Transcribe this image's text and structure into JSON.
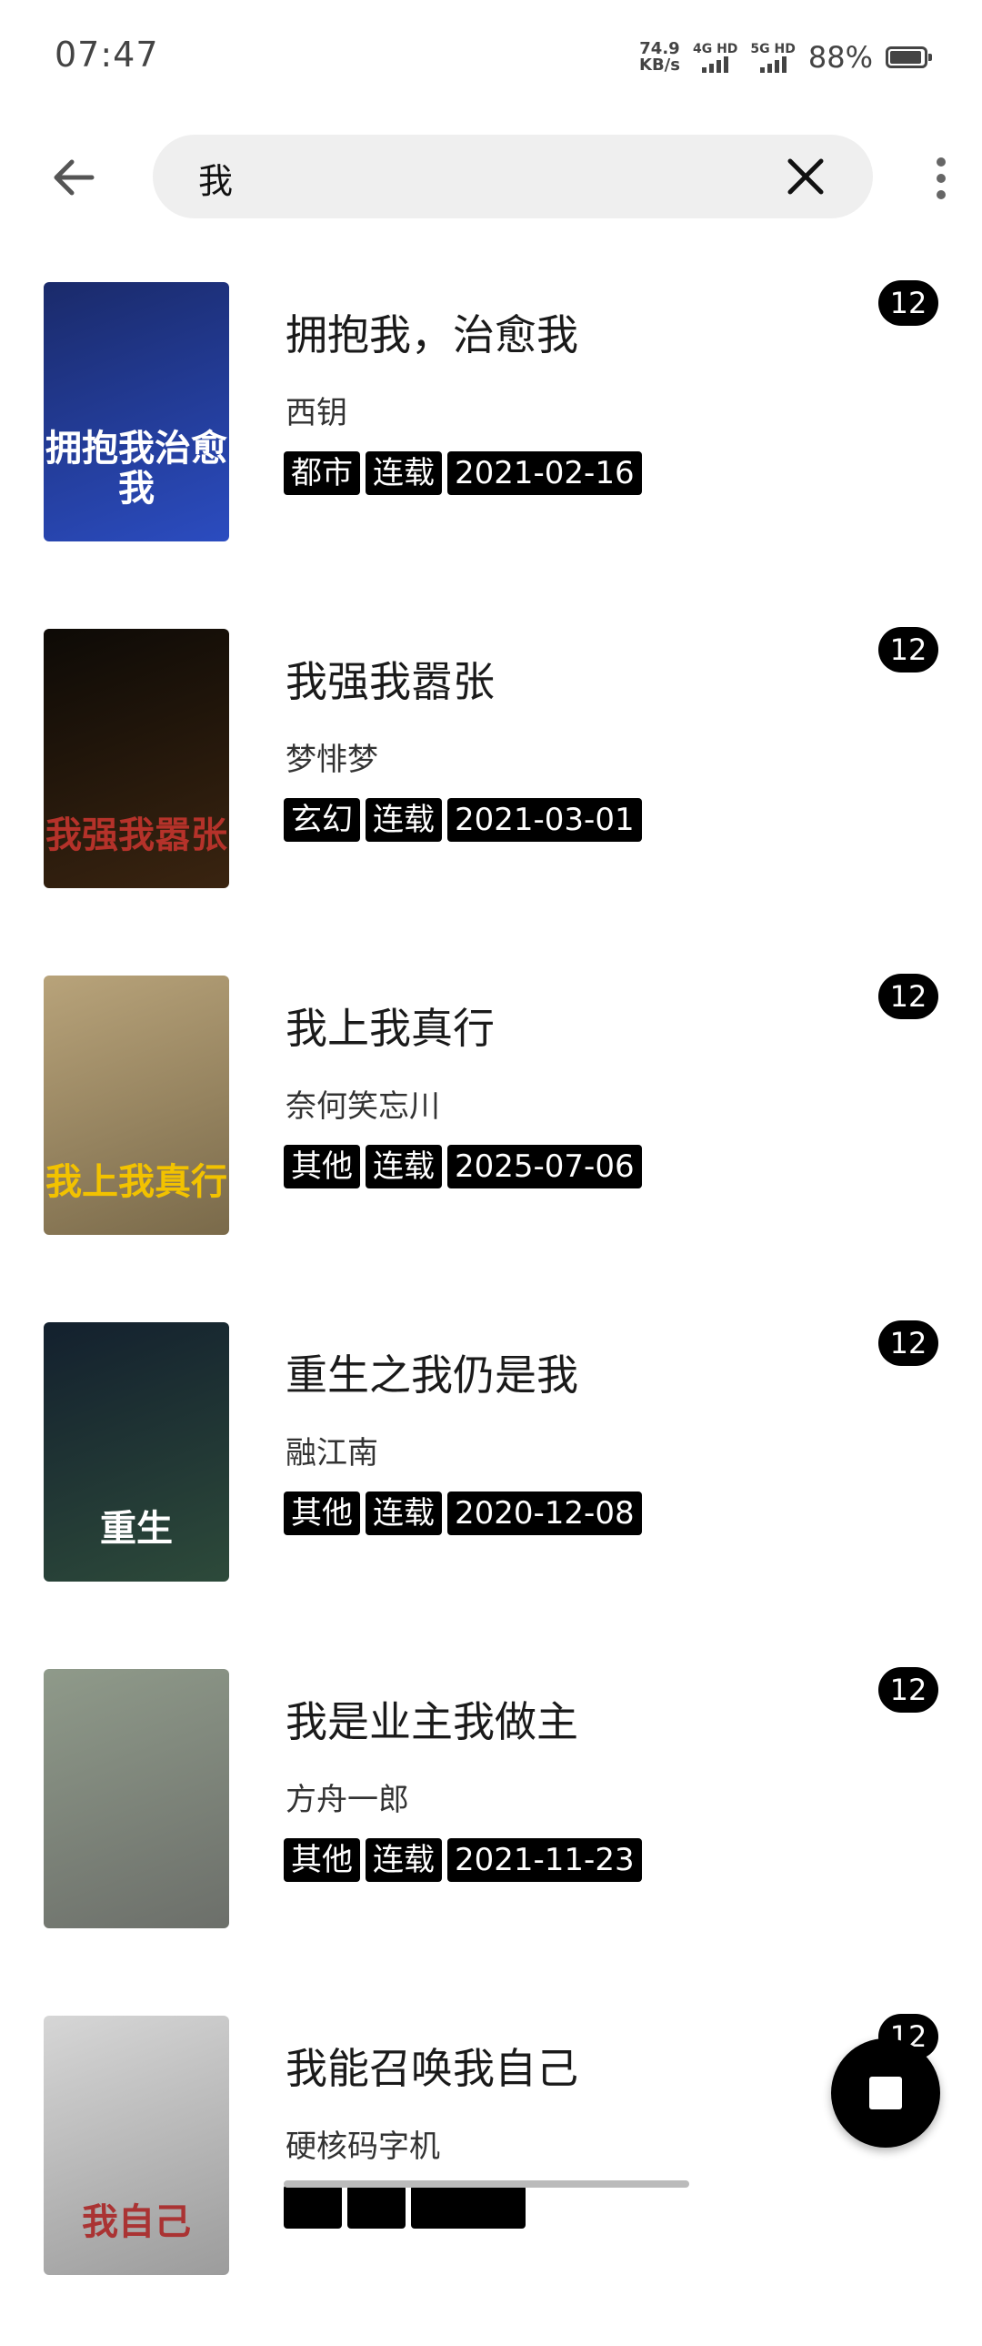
{
  "status": {
    "time": "07:47",
    "net_speed_value": "74.9",
    "net_speed_unit": "KB/s",
    "sim1_label": "4G HD",
    "sim2_label": "5G HD",
    "battery": "88%"
  },
  "search": {
    "query": "我"
  },
  "books": [
    {
      "title": "拥抱我，治愈我",
      "author": "西钥",
      "tags": [
        "都市",
        "连载",
        "2021-02-16"
      ],
      "badge": "12",
      "cover_colors": [
        "#1a2a6a",
        "#2b4cc0"
      ],
      "cover_text": "拥抱我治愈我"
    },
    {
      "title": "我强我嚣张",
      "author": "梦悱梦",
      "tags": [
        "玄幻",
        "连载",
        "2021-03-01"
      ],
      "badge": "12",
      "cover_colors": [
        "#0d0a06",
        "#3a2410"
      ],
      "cover_text": "我强我嚣张"
    },
    {
      "title": "我上我真行",
      "author": "奈何笑忘川",
      "tags": [
        "其他",
        "连载",
        "2025-07-06"
      ],
      "badge": "12",
      "cover_colors": [
        "#b8a37a",
        "#7a6a4a"
      ],
      "cover_text": "我上我真行"
    },
    {
      "title": "重生之我仍是我",
      "author": "融江南",
      "tags": [
        "其他",
        "连载",
        "2020-12-08"
      ],
      "badge": "12",
      "cover_colors": [
        "#13202e",
        "#2d4a3a"
      ],
      "cover_text": "重生"
    },
    {
      "title": "我是业主我做主",
      "author": "方舟一郎",
      "tags": [
        "其他",
        "连载",
        "2021-11-23"
      ],
      "badge": "12",
      "cover_colors": [
        "#8f9a8a",
        "#6c6f6a"
      ],
      "cover_text": ""
    },
    {
      "title": "我能召唤我自己",
      "author": "硬核码字机",
      "tags": [
        "",
        "",
        ""
      ],
      "badge": "12",
      "cover_colors": [
        "#d6d6d6",
        "#9c9c9c"
      ],
      "cover_text": "我自己"
    }
  ]
}
